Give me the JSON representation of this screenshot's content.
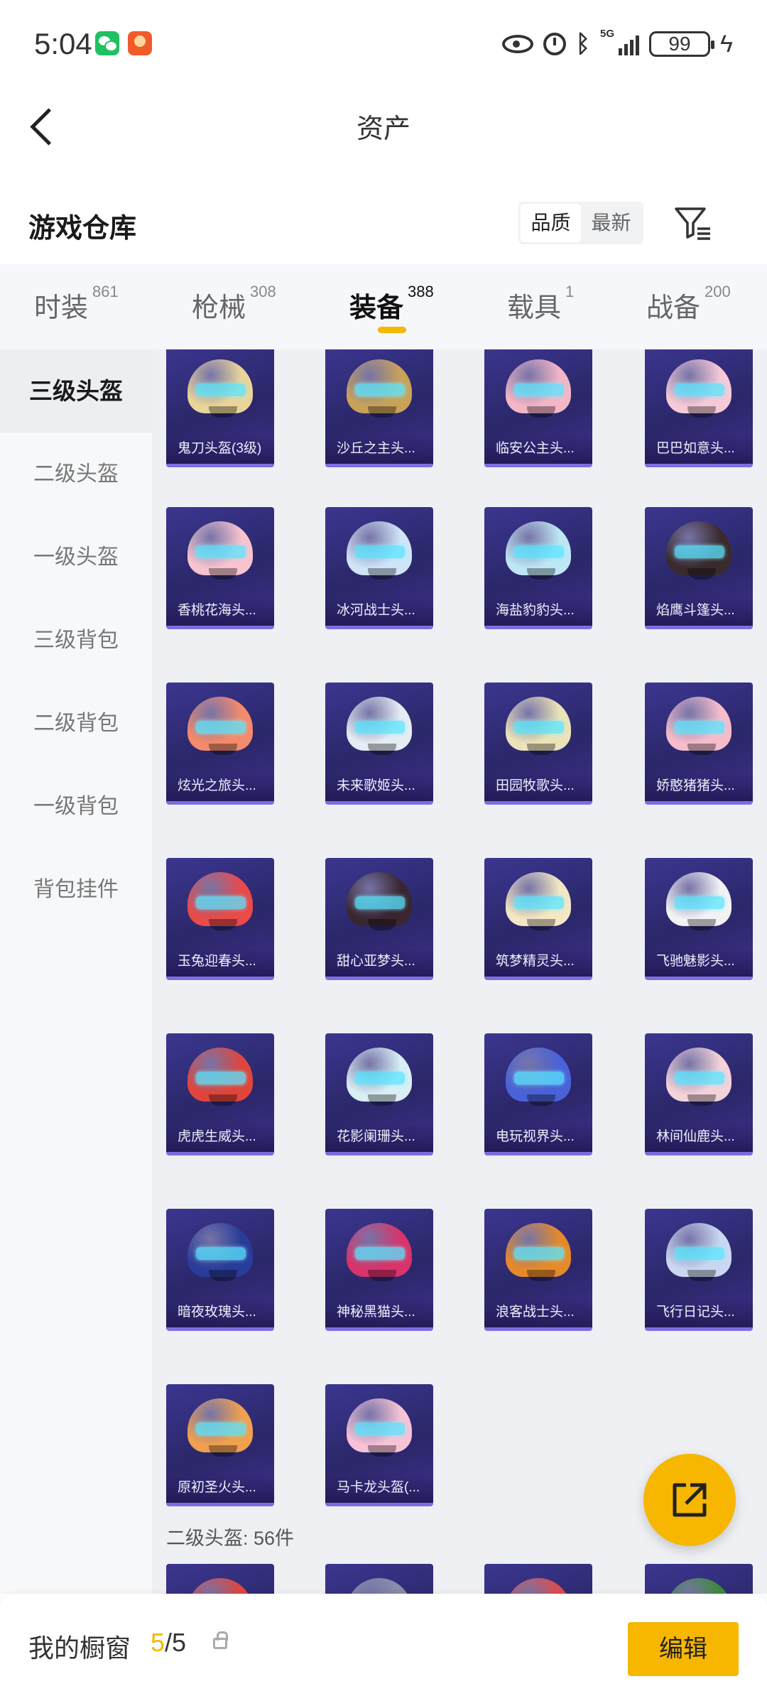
{
  "status_bar": {
    "time": "5:04",
    "signal_label": "5G",
    "battery": "99"
  },
  "header": {
    "title": "资产"
  },
  "warehouse": {
    "title": "游戏仓库",
    "sort_options": [
      "品质",
      "最新"
    ]
  },
  "tabs": [
    {
      "label": "时装",
      "count": "861"
    },
    {
      "label": "枪械",
      "count": "308"
    },
    {
      "label": "装备",
      "count": "388"
    },
    {
      "label": "载具",
      "count": "1"
    },
    {
      "label": "战备",
      "count": "200"
    }
  ],
  "side_nav": [
    "三级头盔",
    "二级头盔",
    "一级头盔",
    "三级背包",
    "二级背包",
    "一级背包",
    "背包挂件"
  ],
  "items": [
    {
      "name": "鬼刀头盔(3级)",
      "color": "#e9d59a"
    },
    {
      "name": "沙丘之主头...",
      "color": "#c9a25a"
    },
    {
      "name": "临安公主头...",
      "color": "#f3b6c6"
    },
    {
      "name": "巴巴如意头...",
      "color": "#f6c9d6"
    },
    {
      "name": "香桃花海头...",
      "color": "#f7c3cf"
    },
    {
      "name": "冰河战士头...",
      "color": "#cfe4f7"
    },
    {
      "name": "海盐豹豹头...",
      "color": "#bfe6f5"
    },
    {
      "name": "焰鹰斗篷头...",
      "color": "#3a2a2e"
    },
    {
      "name": "炫光之旅头...",
      "color": "#f58a6a"
    },
    {
      "name": "未来歌姬头...",
      "color": "#e6ecf3"
    },
    {
      "name": "田园牧歌头...",
      "color": "#ece3b8"
    },
    {
      "name": "娇憨猪猪头...",
      "color": "#f5bccb"
    },
    {
      "name": "玉兔迎春头...",
      "color": "#e94a4a"
    },
    {
      "name": "甜心亚梦头...",
      "color": "#3a2630"
    },
    {
      "name": "筑梦精灵头...",
      "color": "#f3e7c4"
    },
    {
      "name": "飞驰魅影头...",
      "color": "#f2f2f4"
    },
    {
      "name": "虎虎生威头...",
      "color": "#e0453b"
    },
    {
      "name": "花影阑珊头...",
      "color": "#d9eef5"
    },
    {
      "name": "电玩视界头...",
      "color": "#4a62d8"
    },
    {
      "name": "林间仙鹿头...",
      "color": "#f3d2d9"
    },
    {
      "name": "暗夜玫瑰头...",
      "color": "#2a3c9a"
    },
    {
      "name": "神秘黑猫头...",
      "color": "#d8336a"
    },
    {
      "name": "浪客战士头...",
      "color": "#e58a2a"
    },
    {
      "name": "飞行日记头...",
      "color": "#cad7f2"
    },
    {
      "name": "原初圣火头...",
      "color": "#f0a050"
    },
    {
      "name": "马卡龙头盔(...",
      "color": "#f6c2d6"
    }
  ],
  "next_items": [
    {
      "color": "#e0453b"
    },
    {
      "color": "#8a8fa8"
    },
    {
      "color": "#e04a4a"
    },
    {
      "color": "#3d8a3a"
    }
  ],
  "section_title": "二级头盔: 56件",
  "bottom_bar": {
    "label": "我的橱窗",
    "current": "5",
    "separator": "/",
    "total": "5",
    "edit_label": "编辑"
  },
  "colors": {
    "accent": "#f7b600",
    "card_bg": "#2b2769"
  }
}
